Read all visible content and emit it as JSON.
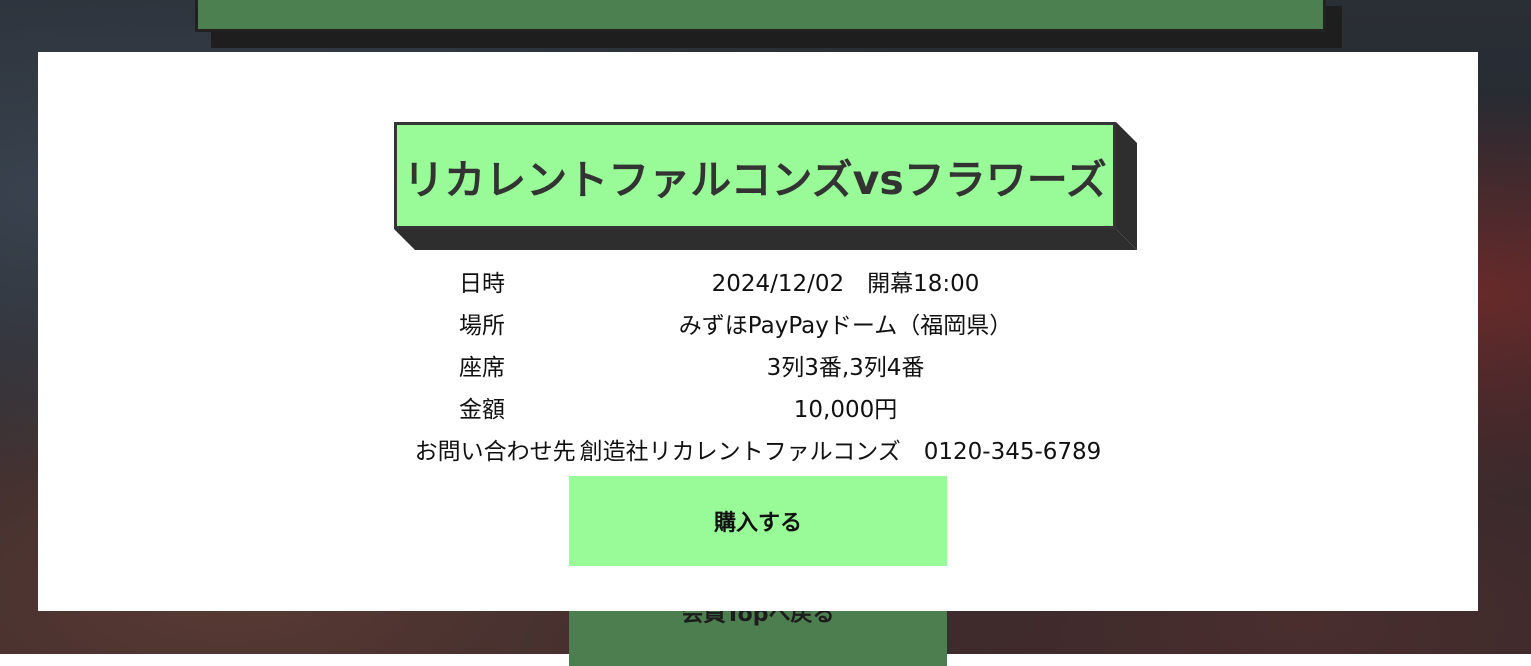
{
  "event": {
    "title": "リカレントファルコンズvsフラワーズ"
  },
  "details": [
    {
      "label": "日時",
      "value": "2024/12/02　開幕18:00"
    },
    {
      "label": "場所",
      "value": "みずほPayPayドーム（福岡県）"
    },
    {
      "label": "座席",
      "value": "3列3番,3列4番"
    },
    {
      "label": "金額",
      "value": "10,000円"
    }
  ],
  "contact": {
    "label": "お問い合わせ先",
    "value": "創造社リカレントファルコンズ　0120-345-6789"
  },
  "buttons": {
    "purchase": "購入する",
    "back_to_top": "会員Topへ戻る"
  },
  "colors": {
    "accent_green": "#99fb98",
    "dark_green": "#4d7e4f",
    "border_dark": "#353535"
  }
}
